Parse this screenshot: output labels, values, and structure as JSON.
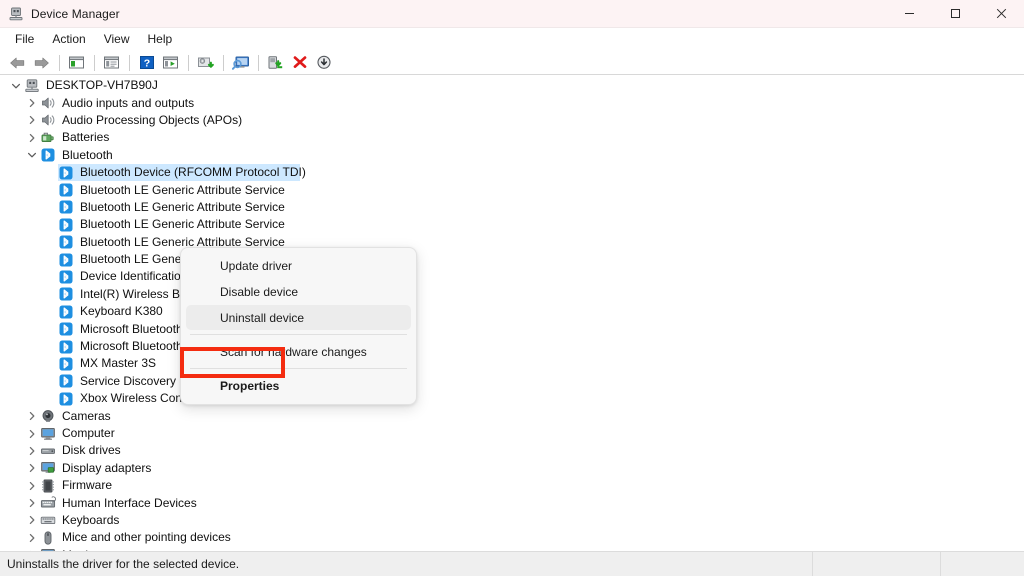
{
  "window": {
    "title": "Device Manager",
    "icon": "device-manager-icon",
    "buttons": {
      "minimize": "minimize-icon",
      "maximize": "maximize-icon",
      "close": "close-icon"
    }
  },
  "menubar": {
    "items": [
      {
        "label": "File"
      },
      {
        "label": "Action"
      },
      {
        "label": "View"
      },
      {
        "label": "Help"
      }
    ]
  },
  "toolbar": {
    "buttons": [
      {
        "name": "back-arrow-icon"
      },
      {
        "name": "forward-arrow-icon"
      },
      {
        "name": "show-hide-console-tree-icon"
      },
      {
        "name": "properties-icon"
      },
      {
        "name": "help-icon"
      },
      {
        "name": "view-icon"
      },
      {
        "name": "update-driver-icon"
      },
      {
        "name": "scan-for-hardware-changes-icon"
      },
      {
        "name": "enable-device-icon"
      },
      {
        "name": "uninstall-device-icon"
      },
      {
        "name": "disable-device-icon"
      }
    ]
  },
  "tree": {
    "nodes": [
      {
        "label": "DESKTOP-VH7B90J",
        "level": 0,
        "state": "expanded",
        "icon": "computer-icon",
        "selected": false
      },
      {
        "label": "Audio inputs and outputs",
        "level": 1,
        "state": "collapsed",
        "icon": "speaker-icon",
        "selected": false
      },
      {
        "label": "Audio Processing Objects (APOs)",
        "level": 1,
        "state": "collapsed",
        "icon": "speaker-icon",
        "selected": false
      },
      {
        "label": "Batteries",
        "level": 1,
        "state": "collapsed",
        "icon": "battery-icon",
        "selected": false
      },
      {
        "label": "Bluetooth",
        "level": 1,
        "state": "expanded",
        "icon": "bluetooth-icon",
        "selected": false
      },
      {
        "label": "Bluetooth Device (RFCOMM Protocol TDI)",
        "level": 2,
        "state": "leaf",
        "icon": "bluetooth-device-icon",
        "selected": true
      },
      {
        "label": "Bluetooth LE Generic Attribute Service",
        "level": 2,
        "state": "leaf",
        "icon": "bluetooth-device-icon",
        "selected": false
      },
      {
        "label": "Bluetooth LE Generic Attribute Service",
        "level": 2,
        "state": "leaf",
        "icon": "bluetooth-device-icon",
        "selected": false
      },
      {
        "label": "Bluetooth LE Generic Attribute Service",
        "level": 2,
        "state": "leaf",
        "icon": "bluetooth-device-icon",
        "selected": false
      },
      {
        "label": "Bluetooth LE Generic Attribute Service",
        "level": 2,
        "state": "leaf",
        "icon": "bluetooth-device-icon",
        "selected": false
      },
      {
        "label": "Bluetooth LE Generic Attribute Service",
        "level": 2,
        "state": "leaf",
        "icon": "bluetooth-device-icon",
        "selected": false
      },
      {
        "label": "Device Identification Service",
        "level": 2,
        "state": "leaf",
        "icon": "bluetooth-device-icon",
        "selected": false
      },
      {
        "label": "Intel(R) Wireless Bluetooth(R)",
        "level": 2,
        "state": "leaf",
        "icon": "bluetooth-device-icon",
        "selected": false
      },
      {
        "label": "Keyboard K380",
        "level": 2,
        "state": "leaf",
        "icon": "bluetooth-device-icon",
        "selected": false
      },
      {
        "label": "Microsoft Bluetooth Enumerator",
        "level": 2,
        "state": "leaf",
        "icon": "bluetooth-device-icon",
        "selected": false
      },
      {
        "label": "Microsoft Bluetooth LE Enumerator",
        "level": 2,
        "state": "leaf",
        "icon": "bluetooth-device-icon",
        "selected": false
      },
      {
        "label": "MX Master 3S",
        "level": 2,
        "state": "leaf",
        "icon": "bluetooth-device-icon",
        "selected": false
      },
      {
        "label": "Service Discovery Service",
        "level": 2,
        "state": "leaf",
        "icon": "bluetooth-device-icon",
        "selected": false
      },
      {
        "label": "Xbox Wireless Controller",
        "level": 2,
        "state": "leaf",
        "icon": "bluetooth-device-icon",
        "selected": false
      },
      {
        "label": "Cameras",
        "level": 1,
        "state": "collapsed",
        "icon": "camera-icon",
        "selected": false
      },
      {
        "label": "Computer",
        "level": 1,
        "state": "collapsed",
        "icon": "monitor-icon",
        "selected": false
      },
      {
        "label": "Disk drives",
        "level": 1,
        "state": "collapsed",
        "icon": "disk-drive-icon",
        "selected": false
      },
      {
        "label": "Display adapters",
        "level": 1,
        "state": "collapsed",
        "icon": "display-adapter-icon",
        "selected": false
      },
      {
        "label": "Firmware",
        "level": 1,
        "state": "collapsed",
        "icon": "firmware-chip-icon",
        "selected": false
      },
      {
        "label": "Human Interface Devices",
        "level": 1,
        "state": "collapsed",
        "icon": "hid-icon",
        "selected": false
      },
      {
        "label": "Keyboards",
        "level": 1,
        "state": "collapsed",
        "icon": "keyboard-icon",
        "selected": false
      },
      {
        "label": "Mice and other pointing devices",
        "level": 1,
        "state": "collapsed",
        "icon": "mouse-icon",
        "selected": false
      },
      {
        "label": "Monitors",
        "level": 1,
        "state": "collapsed",
        "icon": "monitor-icon",
        "selected": false
      }
    ]
  },
  "context_menu": {
    "items": [
      {
        "label": "Update driver",
        "state": "normal"
      },
      {
        "label": "Disable device",
        "state": "normal"
      },
      {
        "label": "Uninstall device",
        "state": "hover"
      },
      {
        "label": "Scan for hardware changes",
        "state": "normal"
      },
      {
        "label": "Properties",
        "state": "highlighted"
      }
    ],
    "highlight_color": "#f42c10"
  },
  "statusbar": {
    "message": "Uninstalls the driver for the selected device.",
    "cell2": "",
    "cell3": ""
  },
  "colors": {
    "titlebar_bg": "#fdf3f4",
    "selection_bg": "#cde8ff",
    "bluetooth_blue": "#1e8fe1",
    "menu_bg": "#f7f7f7",
    "statusbar_bg": "#efefef",
    "red_highlight": "#f42c10"
  }
}
